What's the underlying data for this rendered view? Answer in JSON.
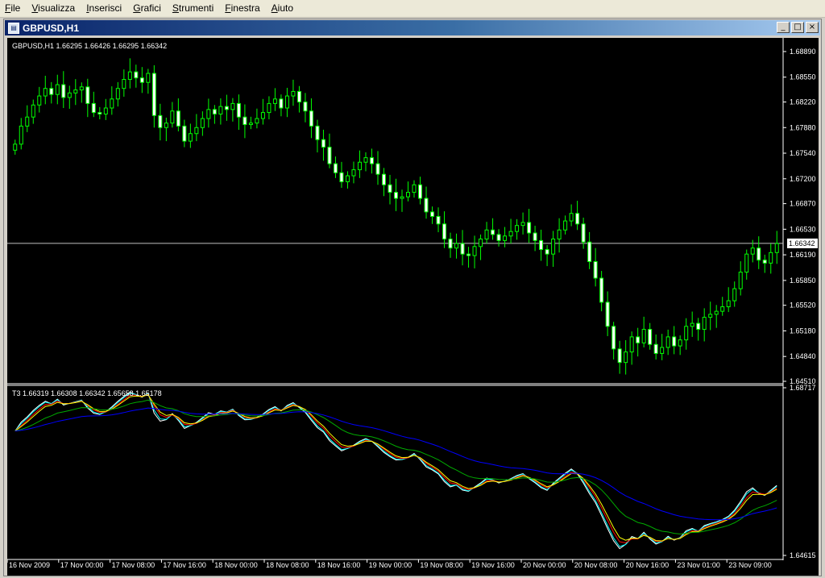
{
  "menu": [
    "File",
    "Visualizza",
    "Inserisci",
    "Grafici",
    "Strumenti",
    "Finestra",
    "Aiuto"
  ],
  "window": {
    "title": "GBPUSD,H1",
    "btn_min": "_",
    "btn_max": "□",
    "btn_close": "×"
  },
  "main_chart": {
    "header": "GBPUSD,H1  1.66295 1.66426 1.66295 1.66342",
    "ylim": [
      1.6451,
      1.6905
    ],
    "ticks": [
      "1.68890",
      "1.68550",
      "1.68220",
      "1.67880",
      "1.67540",
      "1.67200",
      "1.66870",
      "1.66530",
      "1.66190",
      "1.65850",
      "1.65520",
      "1.65180",
      "1.64840",
      "1.64510"
    ],
    "current_price": "1.66342",
    "current_value": 1.66342,
    "up_color": "#00ff00",
    "candle_color": "#ffffff",
    "closes": [
      1.6766,
      1.679,
      1.6802,
      1.6818,
      1.683,
      1.684,
      1.6832,
      1.6845,
      1.6828,
      1.6834,
      1.6838,
      1.6842,
      1.682,
      1.6808,
      1.6806,
      1.6814,
      1.6826,
      1.684,
      1.6852,
      1.6862,
      1.6854,
      1.6848,
      1.686,
      1.6804,
      1.6788,
      1.6794,
      1.681,
      1.679,
      1.677,
      1.678,
      1.6788,
      1.68,
      1.6812,
      1.6806,
      1.6816,
      1.6812,
      1.682,
      1.6802,
      1.6792,
      1.6794,
      1.68,
      1.6808,
      1.682,
      1.6826,
      1.6814,
      1.683,
      1.6836,
      1.6822,
      1.681,
      1.679,
      1.6772,
      1.6762,
      1.674,
      1.6728,
      1.6716,
      1.6724,
      1.6732,
      1.6742,
      1.6748,
      1.674,
      1.6726,
      1.6712,
      1.6702,
      1.6694,
      1.6696,
      1.6702,
      1.6712,
      1.6694,
      1.6676,
      1.667,
      1.666,
      1.664,
      1.6628,
      1.6634,
      1.662,
      1.6618,
      1.663,
      1.664,
      1.6652,
      1.6646,
      1.6638,
      1.6644,
      1.665,
      1.6658,
      1.6662,
      1.6648,
      1.6638,
      1.6626,
      1.662,
      1.664,
      1.6652,
      1.6664,
      1.6674,
      1.666,
      1.6636,
      1.661,
      1.6588,
      1.6556,
      1.6524,
      1.6494,
      1.6476,
      1.649,
      1.651,
      1.6502,
      1.652,
      1.65,
      1.6488,
      1.6496,
      1.651,
      1.6498,
      1.6506,
      1.6524,
      1.6528,
      1.652,
      1.6536,
      1.654,
      1.6544,
      1.655,
      1.6558,
      1.6574,
      1.6596,
      1.662,
      1.6628,
      1.6612,
      1.6608,
      1.6622,
      1.6634
    ]
  },
  "indicator": {
    "header": "T3 1.66319 1.66308 1.66342 1.65658 1.65178",
    "ylim": [
      1.64615,
      1.68717
    ],
    "ticks": [
      "1.68717",
      "1.64615"
    ],
    "line_colors": [
      "#ffffff",
      "#00ffff",
      "#ff0000",
      "#ffff00",
      "#00aa00",
      "#0000ff"
    ]
  },
  "x_axis": [
    "16 Nov 2009",
    "17 Nov 00:00",
    "17 Nov 08:00",
    "17 Nov 16:00",
    "18 Nov 00:00",
    "18 Nov 08:00",
    "18 Nov 16:00",
    "19 Nov 00:00",
    "19 Nov 08:00",
    "19 Nov 16:00",
    "20 Nov 00:00",
    "20 Nov 08:00",
    "20 Nov 16:00",
    "23 Nov 01:00",
    "23 Nov 09:00"
  ]
}
